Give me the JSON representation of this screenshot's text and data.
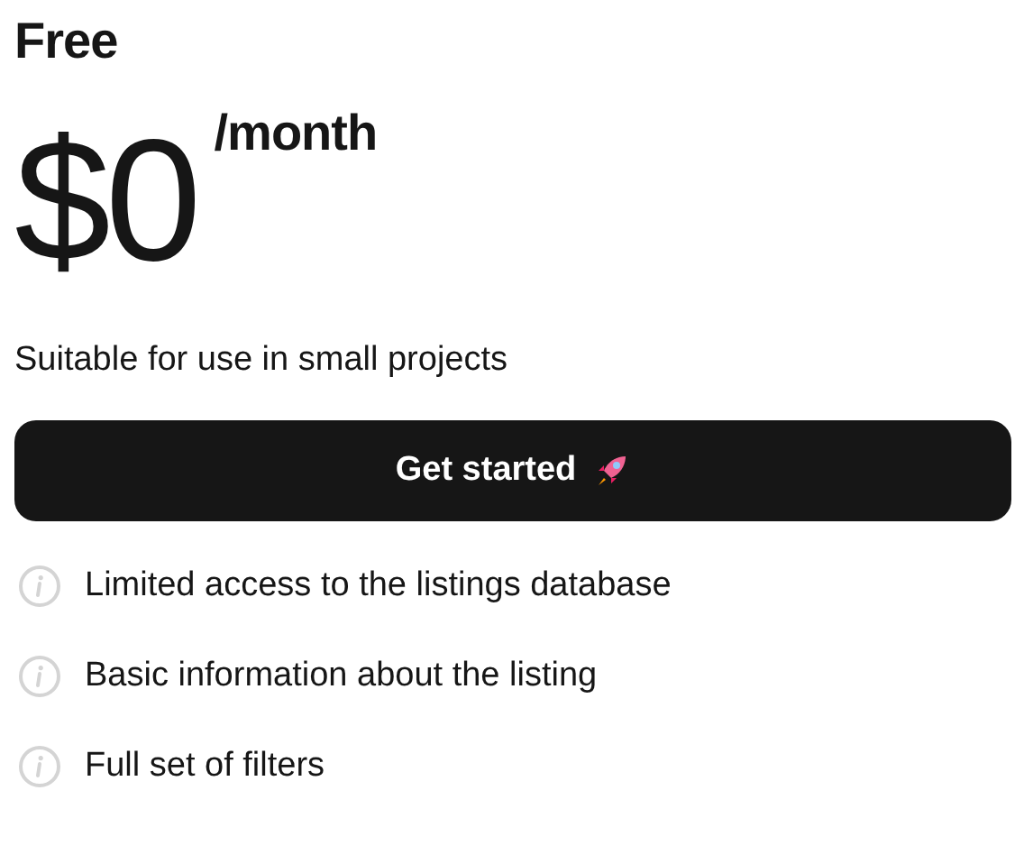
{
  "plan": {
    "name": "Free",
    "price": "$0",
    "period": "/month",
    "description": "Suitable for use in small projects"
  },
  "button": {
    "label": "Get started"
  },
  "features": [
    {
      "text": "Limited access to the listings database"
    },
    {
      "text": "Basic information about the listing"
    },
    {
      "text": "Full set of filters"
    }
  ]
}
